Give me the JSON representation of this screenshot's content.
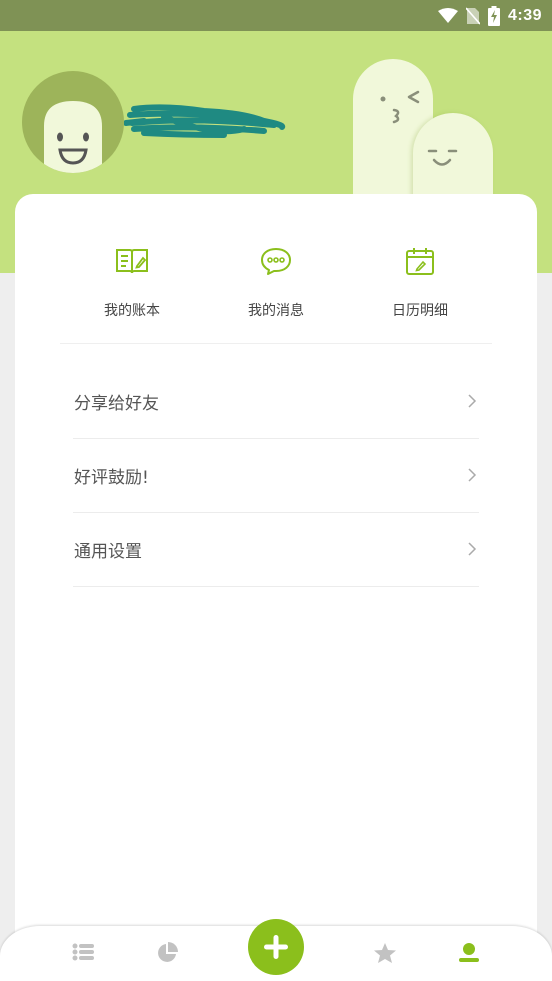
{
  "status_bar": {
    "time": "4:39",
    "icons": [
      "wifi-icon",
      "no-sim-icon",
      "battery-charging-icon"
    ]
  },
  "profile": {
    "avatar_icon": "smiley-face-icon"
  },
  "quick_actions": [
    {
      "label": "我的账本",
      "icon": "ledger-book-icon"
    },
    {
      "label": "我的消息",
      "icon": "chat-bubble-icon"
    },
    {
      "label": "日历明细",
      "icon": "calendar-icon"
    }
  ],
  "menu": [
    {
      "label": "分享给好友"
    },
    {
      "label": "好评鼓励!"
    },
    {
      "label": "通用设置"
    }
  ],
  "tabbar": {
    "tabs": [
      "list-icon",
      "pie-chart-icon",
      "add-icon",
      "star-icon",
      "user-icon"
    ],
    "active": "user-icon"
  },
  "colors": {
    "accent": "#8bbf1c",
    "header": "#c4e17f",
    "status_bar": "#7f9255"
  }
}
